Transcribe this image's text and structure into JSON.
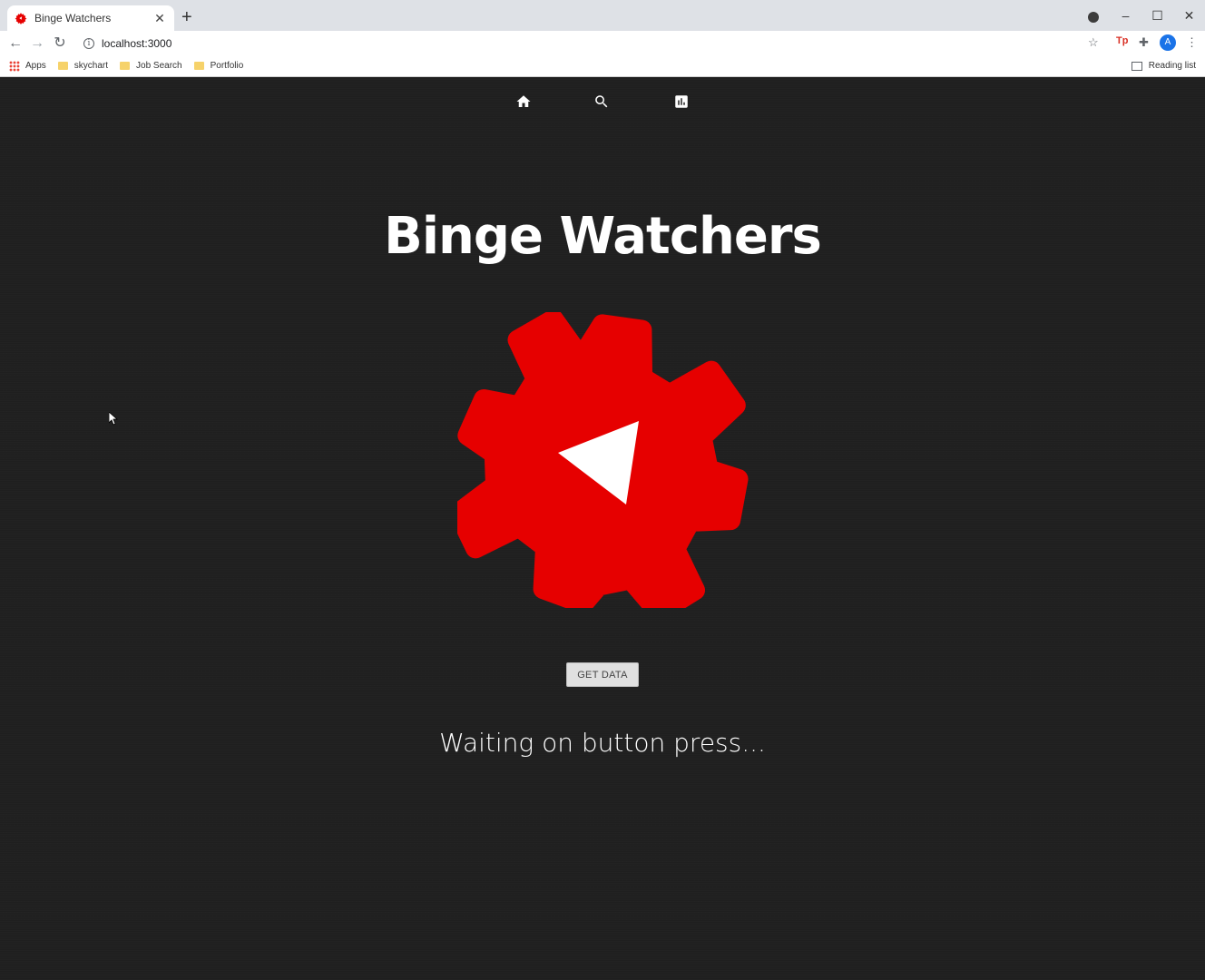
{
  "browser": {
    "tab_title": "Binge Watchers",
    "url": "localhost:3000",
    "bookmarks": [
      {
        "label": "Apps",
        "icon": "apps-grid-icon"
      },
      {
        "label": "skychart",
        "icon": "folder-icon"
      },
      {
        "label": "Job Search",
        "icon": "folder-icon"
      },
      {
        "label": "Portfolio",
        "icon": "folder-icon"
      }
    ],
    "reading_list": "Reading list",
    "avatar_initial": "A"
  },
  "navbar": {
    "items": [
      {
        "icon": "home-icon"
      },
      {
        "icon": "search-icon"
      },
      {
        "icon": "bar-chart-icon"
      }
    ]
  },
  "page": {
    "title": "Binge Watchers",
    "button_label": "GET DATA",
    "status": "Waiting on button press..."
  },
  "colors": {
    "brand_red": "#e60000",
    "background": "#1f1f1f",
    "text": "#ffffff"
  }
}
